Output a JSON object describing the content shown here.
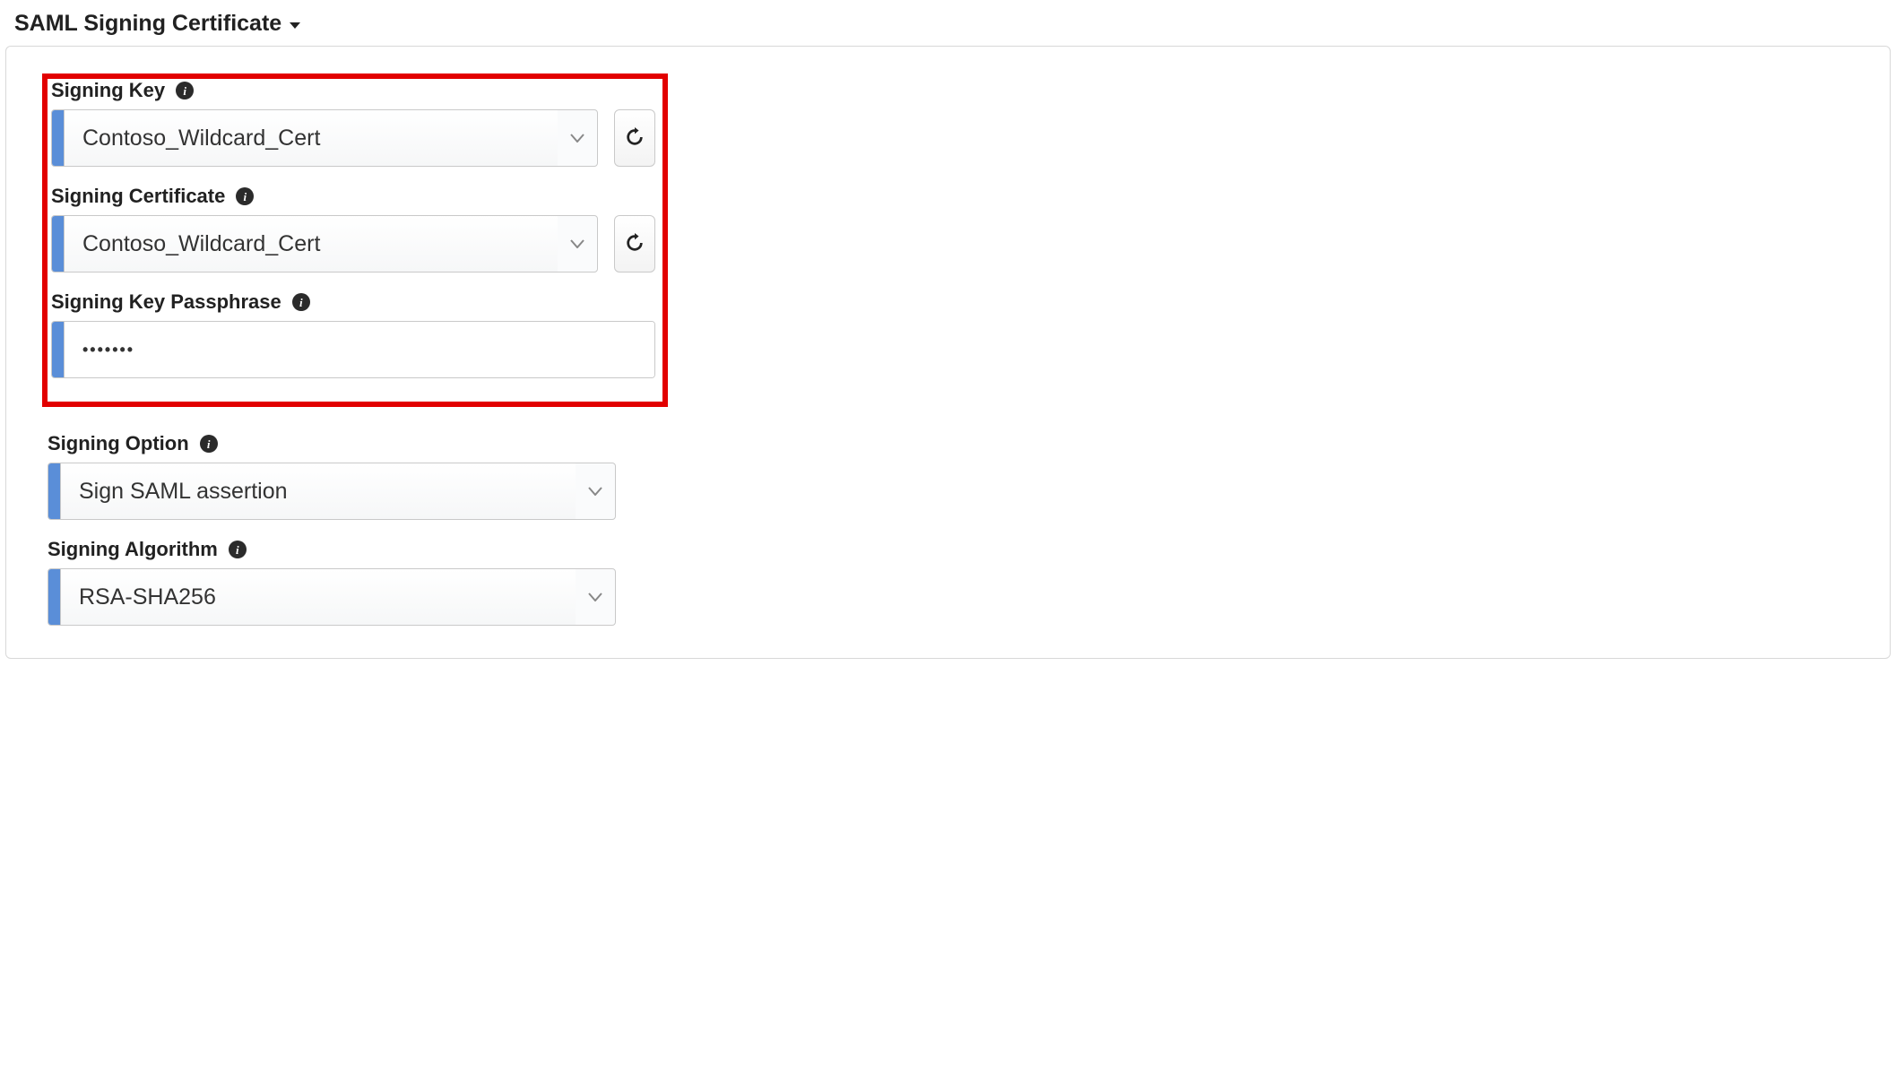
{
  "section": {
    "title": "SAML Signing Certificate"
  },
  "fields": {
    "signing_key": {
      "label": "Signing Key",
      "value": "Contoso_Wildcard_Cert"
    },
    "signing_certificate": {
      "label": "Signing Certificate",
      "value": "Contoso_Wildcard_Cert"
    },
    "signing_key_passphrase": {
      "label": "Signing Key Passphrase",
      "masked_value": "•••••••"
    },
    "signing_option": {
      "label": "Signing Option",
      "value": "Sign SAML assertion"
    },
    "signing_algorithm": {
      "label": "Signing Algorithm",
      "value": "RSA-SHA256"
    }
  },
  "icons": {
    "info": "i"
  }
}
